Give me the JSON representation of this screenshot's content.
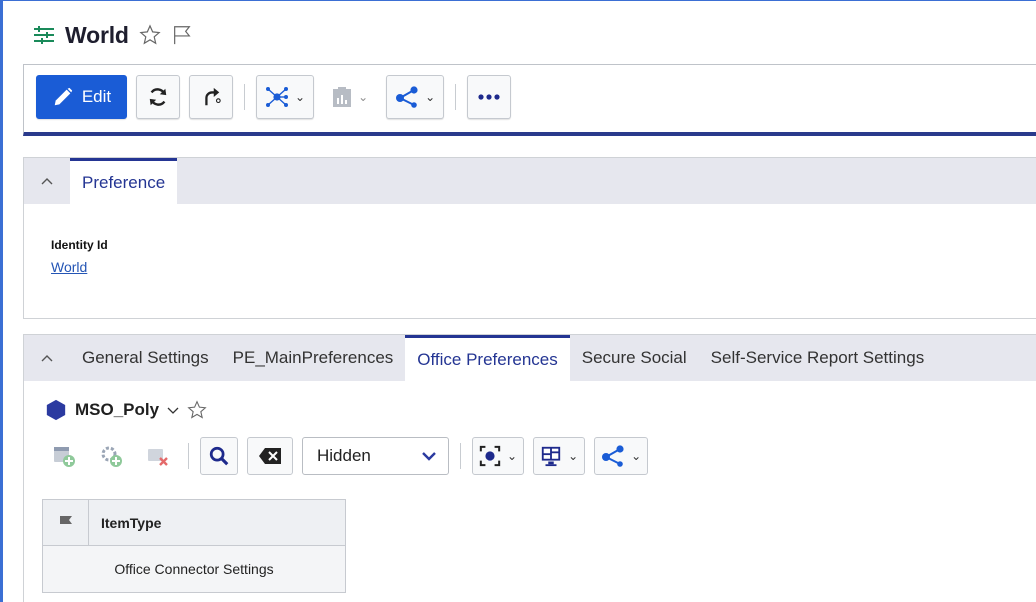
{
  "window": {
    "title": "World"
  },
  "toolbar": {
    "edit_label": "Edit"
  },
  "preference_panel": {
    "tab": "Preference",
    "field": {
      "label": "Identity Id",
      "value": "World"
    }
  },
  "settings_panel": {
    "tabs": [
      {
        "label": "General Settings",
        "active": false
      },
      {
        "label": "PE_MainPreferences",
        "active": false
      },
      {
        "label": "Office Preferences",
        "active": true
      },
      {
        "label": "Secure Social",
        "active": false
      },
      {
        "label": "Self-Service Report Settings",
        "active": false
      }
    ]
  },
  "item": {
    "name": "MSO_Poly"
  },
  "grid_toolbar": {
    "select_value": "Hidden"
  },
  "table": {
    "columns": [
      "ItemType"
    ],
    "rows": [
      [
        "Office Connector Settings"
      ]
    ]
  },
  "colors": {
    "accent": "#1a5cd6",
    "tab_active": "#243593",
    "item_icon": "#2b3aa0",
    "title_icon": "#1a8a5a"
  }
}
